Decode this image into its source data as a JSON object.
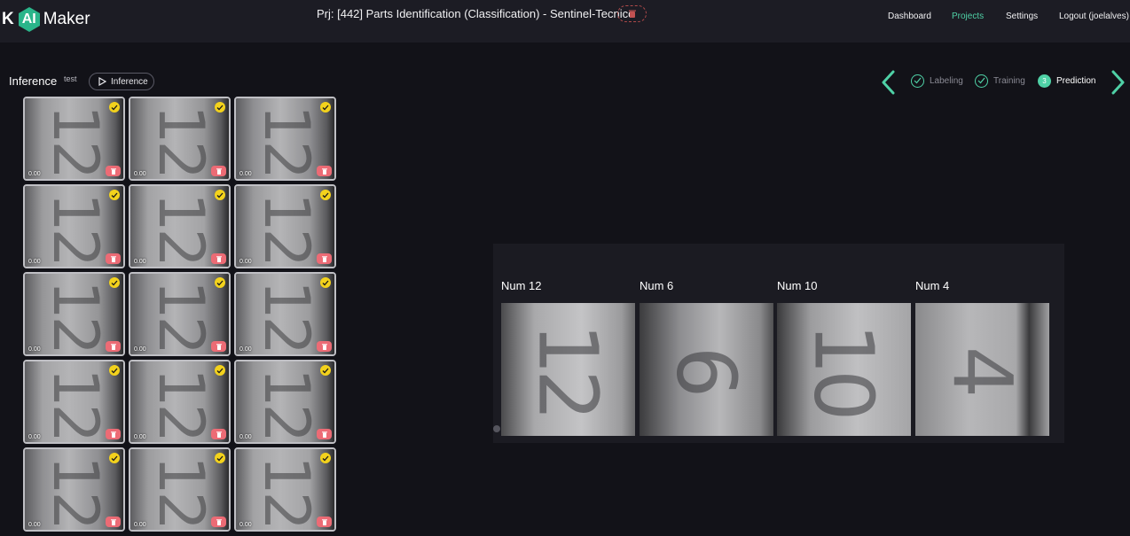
{
  "header": {
    "logo": {
      "k": "K",
      "ai": "AI",
      "maker": "Maker"
    },
    "project_title": "Prj: [442] Parts Identification (Classification) - Sentinel-Tecnico",
    "nav": [
      {
        "label": "Dashboard",
        "active": false
      },
      {
        "label": "Projects",
        "active": true
      },
      {
        "label": "Settings",
        "active": false
      },
      {
        "label": "Logout (joelalves)",
        "active": false
      }
    ],
    "accent_color": "#4fd1a6"
  },
  "inference": {
    "title": "Inference",
    "subtitle": "test",
    "button_label": "Inference"
  },
  "grid": {
    "columns": 3,
    "rows": 5,
    "items": [
      {
        "score": "0.00",
        "digit": "12"
      },
      {
        "score": "0.00",
        "digit": "12"
      },
      {
        "score": "0.00",
        "digit": "12"
      },
      {
        "score": "0.00",
        "digit": "12"
      },
      {
        "score": "0.00",
        "digit": "12"
      },
      {
        "score": "0.00",
        "digit": "12"
      },
      {
        "score": "0.00",
        "digit": "12"
      },
      {
        "score": "0.00",
        "digit": "12"
      },
      {
        "score": "0.00",
        "digit": "12"
      },
      {
        "score": "0.00",
        "digit": "12"
      },
      {
        "score": "0.00",
        "digit": "12"
      },
      {
        "score": "0.00",
        "digit": "12"
      },
      {
        "score": "0.00",
        "digit": "12"
      },
      {
        "score": "0.00",
        "digit": "12"
      },
      {
        "score": "0.00",
        "digit": "12"
      }
    ]
  },
  "stepper": {
    "steps": [
      {
        "label": "Labeling",
        "state": "done"
      },
      {
        "label": "Training",
        "state": "done"
      },
      {
        "label": "Prediction",
        "state": "current",
        "number": "3"
      }
    ]
  },
  "prediction": {
    "classes": [
      {
        "label": "Num 12",
        "digit": "12"
      },
      {
        "label": "Num 6",
        "digit": "6"
      },
      {
        "label": "Num 10",
        "digit": "10"
      },
      {
        "label": "Num 4",
        "digit": "4"
      }
    ],
    "carousel_dots": 4,
    "active_dot": 3
  }
}
